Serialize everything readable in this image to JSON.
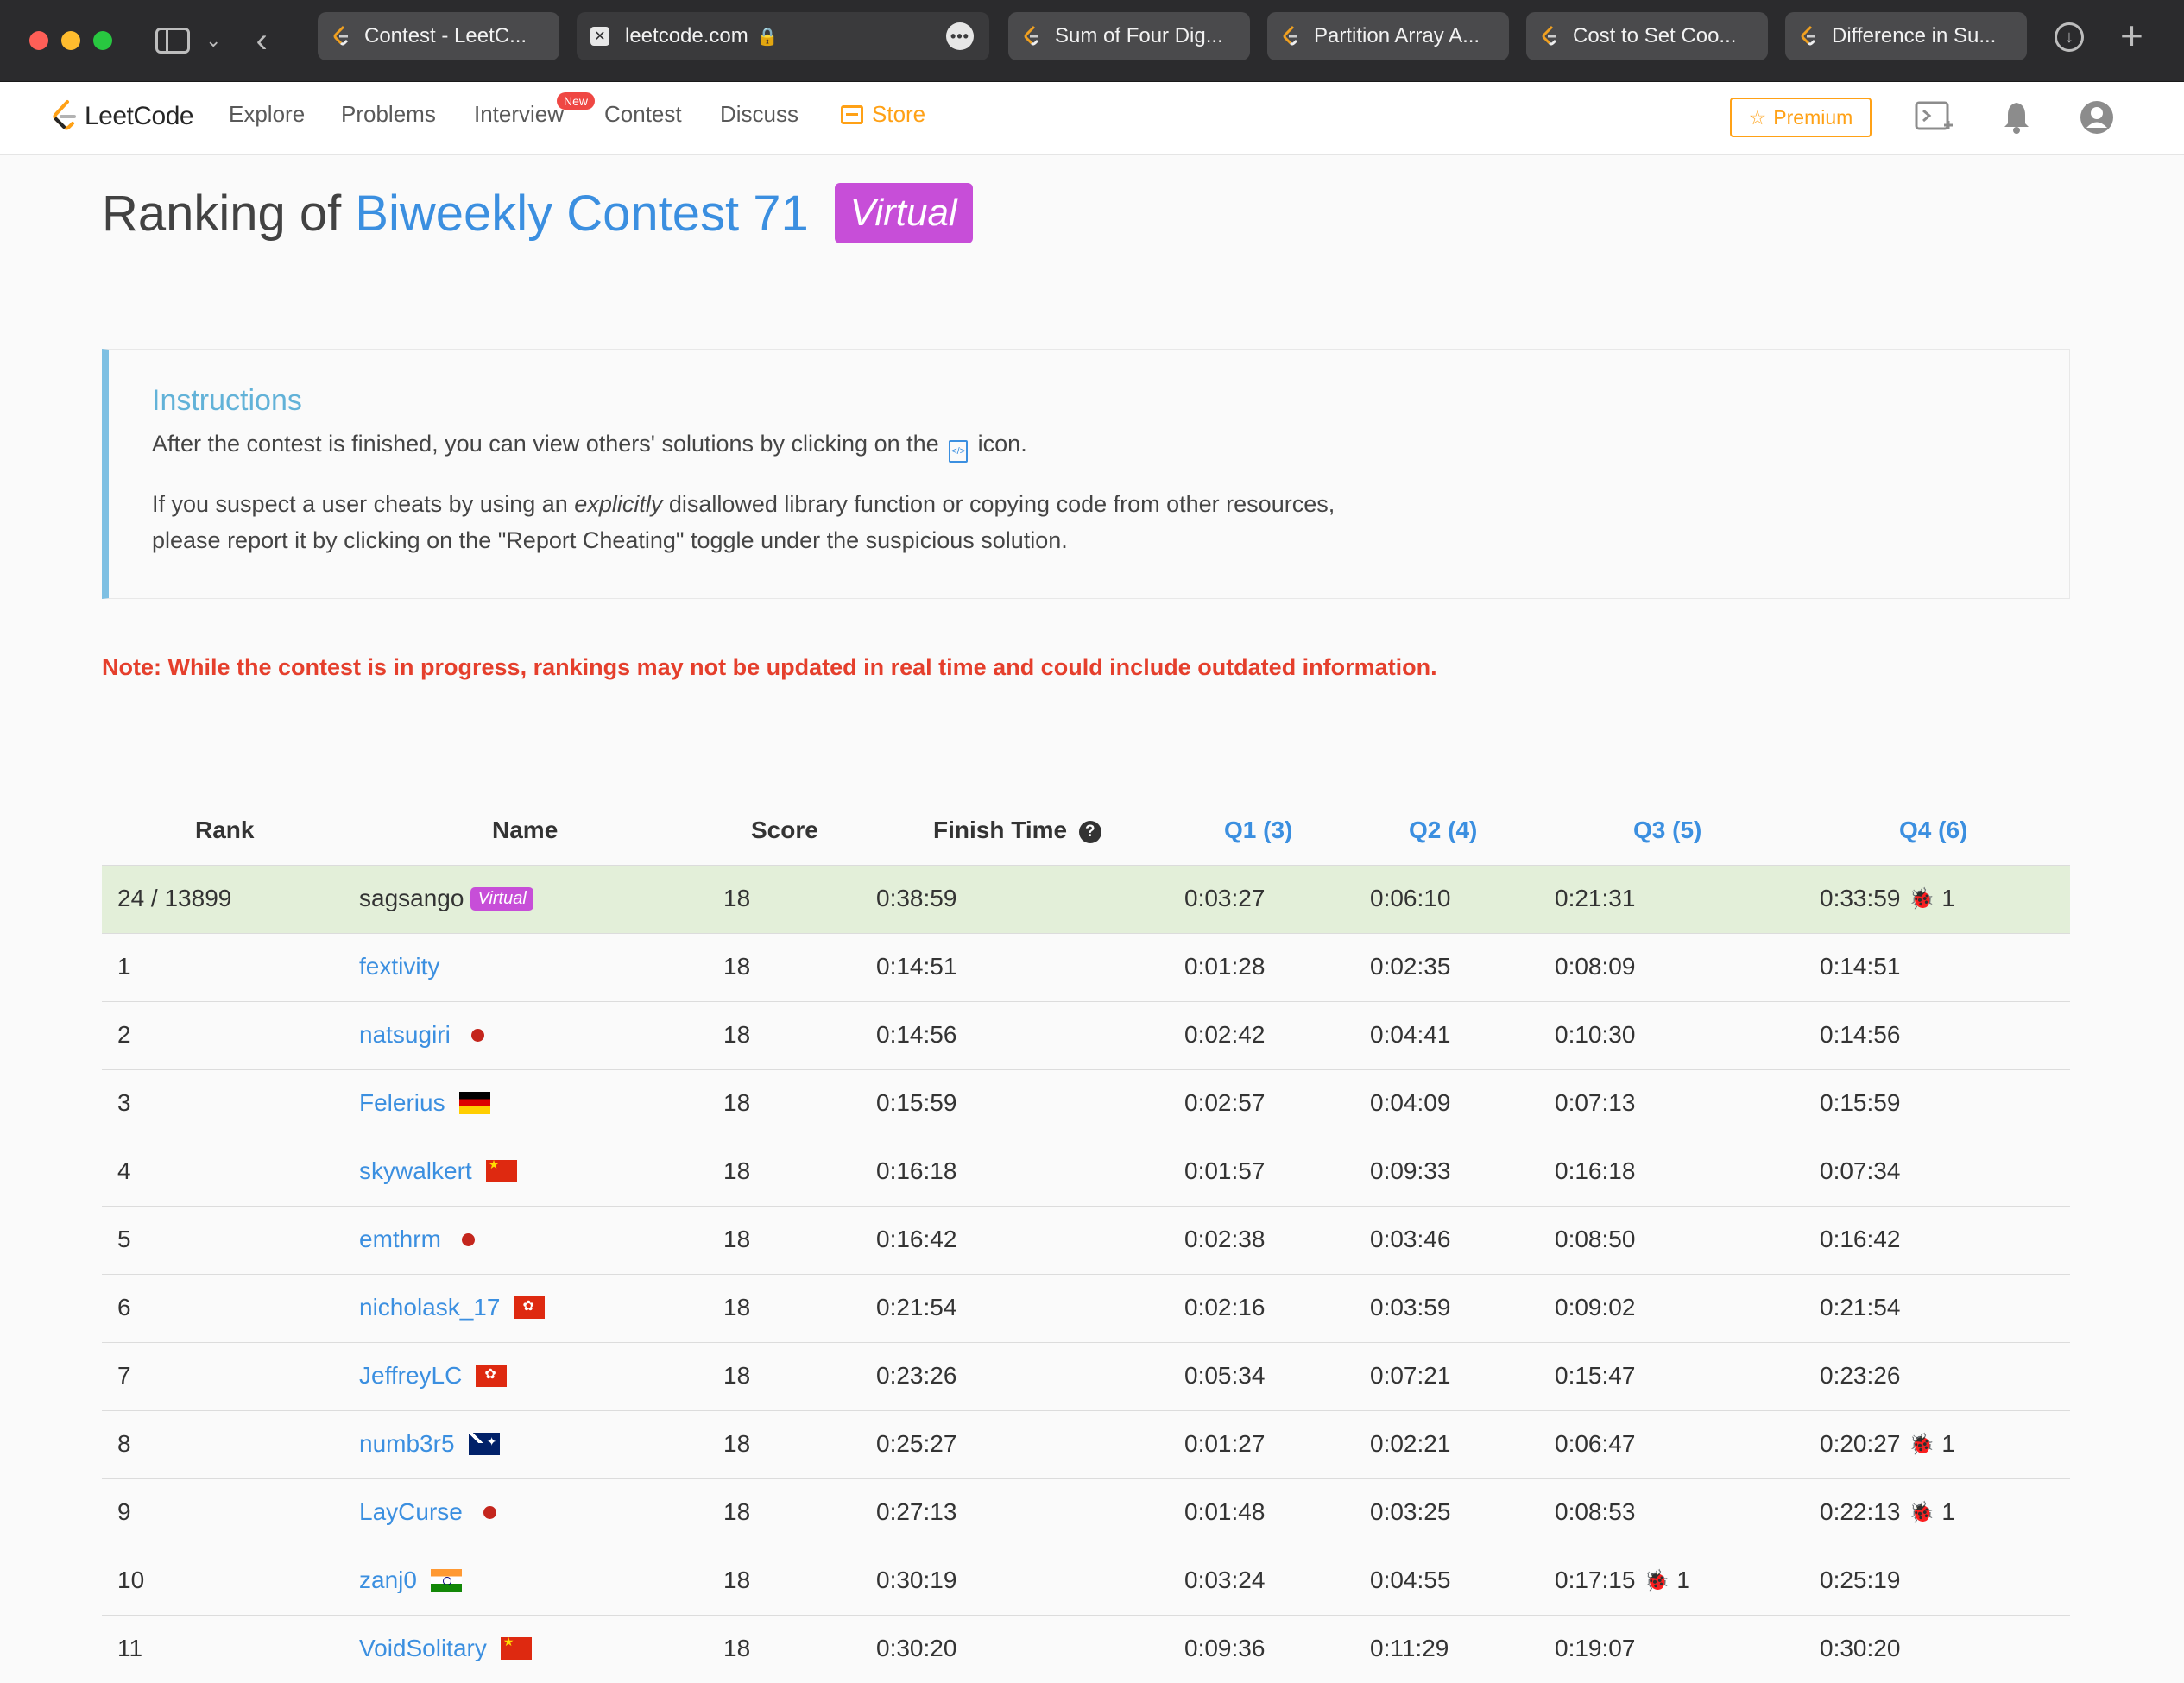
{
  "browser": {
    "tabs": [
      {
        "title": "Contest - LeetC..."
      },
      {
        "title": "leetcode.com"
      },
      {
        "title": "Sum of Four Dig..."
      },
      {
        "title": "Partition Array A..."
      },
      {
        "title": "Cost to Set Coo..."
      },
      {
        "title": "Difference in Su..."
      }
    ]
  },
  "nav": {
    "brand": "LeetCode",
    "items": [
      "Explore",
      "Problems",
      "Interview",
      "Contest",
      "Discuss",
      "Store"
    ],
    "new_badge": "New",
    "premium": "Premium",
    "icons": [
      "console-icon",
      "bell-icon",
      "user-avatar-icon"
    ]
  },
  "page": {
    "title_prefix": "Ranking of",
    "contest_name": "Biweekly Contest 71",
    "virtual_tag": "Virtual"
  },
  "instructions": {
    "title": "Instructions",
    "line1_before": "After the contest is finished, you can view others' solutions by clicking on the",
    "line1_after": "icon.",
    "line2_before": "If you suspect a user cheats by using an",
    "line2_em": "explicitly",
    "line2_after": "disallowed library function or copying code from other resources,",
    "line3": "please report it by clicking on the \"Report Cheating\" toggle under the suspicious solution."
  },
  "note": "Note: While the contest is in progress, rankings may not be updated in real time and could include outdated information.",
  "table": {
    "headers": {
      "rank": "Rank",
      "name": "Name",
      "score": "Score",
      "finish": "Finish Time",
      "q1": "Q1 (3)",
      "q2": "Q2 (4)",
      "q3": "Q3 (5)",
      "q4": "Q4 (6)"
    },
    "rows": [
      {
        "rank": "24 / 13899",
        "name": "sagsango",
        "virtual": "Virtual",
        "flag": "",
        "score": "18",
        "finish": "0:38:59",
        "q1": "0:03:27",
        "q2": "0:06:10",
        "q3": "0:21:31",
        "q4": "0:33:59",
        "q3_bugs": "",
        "q4_bugs": "1"
      },
      {
        "rank": "1",
        "name": "fextivity",
        "flag": "",
        "score": "18",
        "finish": "0:14:51",
        "q1": "0:01:28",
        "q2": "0:02:35",
        "q3": "0:08:09",
        "q4": "0:14:51",
        "q3_bugs": "",
        "q4_bugs": ""
      },
      {
        "rank": "2",
        "name": "natsugiri",
        "flag": "jp",
        "score": "18",
        "finish": "0:14:56",
        "q1": "0:02:42",
        "q2": "0:04:41",
        "q3": "0:10:30",
        "q4": "0:14:56",
        "q3_bugs": "",
        "q4_bugs": ""
      },
      {
        "rank": "3",
        "name": "Felerius",
        "flag": "de",
        "score": "18",
        "finish": "0:15:59",
        "q1": "0:02:57",
        "q2": "0:04:09",
        "q3": "0:07:13",
        "q4": "0:15:59",
        "q3_bugs": "",
        "q4_bugs": ""
      },
      {
        "rank": "4",
        "name": "skywalkert",
        "flag": "cn",
        "score": "18",
        "finish": "0:16:18",
        "q1": "0:01:57",
        "q2": "0:09:33",
        "q3": "0:16:18",
        "q4": "0:07:34",
        "q3_bugs": "",
        "q4_bugs": ""
      },
      {
        "rank": "5",
        "name": "emthrm",
        "flag": "jp",
        "score": "18",
        "finish": "0:16:42",
        "q1": "0:02:38",
        "q2": "0:03:46",
        "q3": "0:08:50",
        "q4": "0:16:42",
        "q3_bugs": "",
        "q4_bugs": ""
      },
      {
        "rank": "6",
        "name": "nicholask_17",
        "flag": "hk",
        "score": "18",
        "finish": "0:21:54",
        "q1": "0:02:16",
        "q2": "0:03:59",
        "q3": "0:09:02",
        "q4": "0:21:54",
        "q3_bugs": "",
        "q4_bugs": ""
      },
      {
        "rank": "7",
        "name": "JeffreyLC",
        "flag": "hk",
        "score": "18",
        "finish": "0:23:26",
        "q1": "0:05:34",
        "q2": "0:07:21",
        "q3": "0:15:47",
        "q4": "0:23:26",
        "q3_bugs": "",
        "q4_bugs": ""
      },
      {
        "rank": "8",
        "name": "numb3r5",
        "flag": "au",
        "score": "18",
        "finish": "0:25:27",
        "q1": "0:01:27",
        "q2": "0:02:21",
        "q3": "0:06:47",
        "q4": "0:20:27",
        "q3_bugs": "",
        "q4_bugs": "1"
      },
      {
        "rank": "9",
        "name": "LayCurse",
        "flag": "jp",
        "score": "18",
        "finish": "0:27:13",
        "q1": "0:01:48",
        "q2": "0:03:25",
        "q3": "0:08:53",
        "q4": "0:22:13",
        "q3_bugs": "",
        "q4_bugs": "1"
      },
      {
        "rank": "10",
        "name": "zanj0",
        "flag": "in",
        "score": "18",
        "finish": "0:30:19",
        "q1": "0:03:24",
        "q2": "0:04:55",
        "q3": "0:17:15",
        "q4": "0:25:19",
        "q3_bugs": "1",
        "q4_bugs": ""
      },
      {
        "rank": "11",
        "name": "VoidSolitary",
        "flag": "cn",
        "score": "18",
        "finish": "0:30:20",
        "q1": "0:09:36",
        "q2": "0:11:29",
        "q3": "0:19:07",
        "q4": "0:30:20",
        "q3_bugs": "",
        "q4_bugs": ""
      }
    ]
  }
}
